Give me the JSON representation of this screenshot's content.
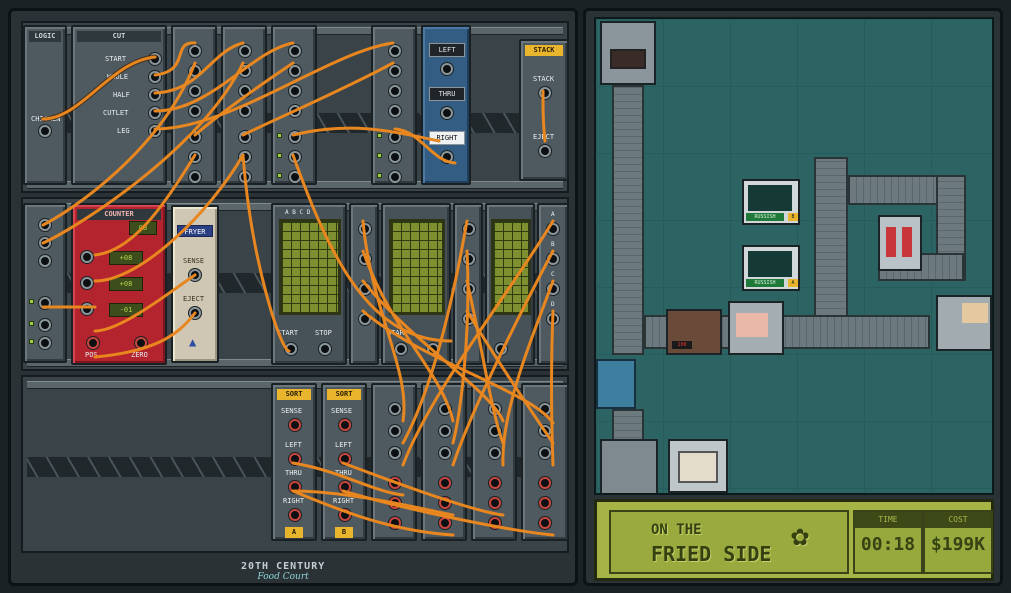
{
  "modules": {
    "chicken": {
      "header": "LOGIC",
      "label": "CHICKEN"
    },
    "cutter": {
      "header": "CUT",
      "labels": [
        "START",
        "WHOLE",
        "HALF",
        "CUTLET",
        "LEG"
      ]
    },
    "sorter": {
      "labels": [
        "LEFT",
        "THRU",
        "RIGHT"
      ]
    },
    "stack": {
      "header": "STACK",
      "label_stack": "STACK",
      "label_eject": "EJECT"
    },
    "counter": {
      "header": "COUNTER",
      "values": [
        "08",
        "+08",
        "+08",
        "-01"
      ],
      "pos_label": "POS",
      "zero_label": "ZERO"
    },
    "fryer": {
      "header": "FRYER",
      "sense_label": "SENSE",
      "eject_label": "EJECT"
    },
    "grid_cols": [
      "A",
      "B",
      "C",
      "D"
    ],
    "grid_start": "START",
    "grid_stop": "STOP",
    "sort_a": {
      "header": "SORT",
      "sense": "SENSE",
      "left": "LEFT",
      "thru": "THRU",
      "right": "RIGHT",
      "tag": "A"
    },
    "sort_b": {
      "header": "SORT",
      "sense": "SENSE",
      "left": "LEFT",
      "thru": "THRU",
      "right": "RIGHT",
      "tag": "B"
    },
    "side_cols": [
      "A",
      "B",
      "C",
      "D"
    ]
  },
  "logo": {
    "line1": "20TH CENTURY",
    "line2": "Food Court"
  },
  "factory": {
    "russish_label": "RUSSISH",
    "tag_a": "A",
    "tag_b": "B",
    "timer_display": "100"
  },
  "status": {
    "title_line1": "ON THE",
    "title_line2": "FRIED SIDE",
    "time_label": "TIME",
    "time_value": "00:18",
    "cost_label": "COST",
    "cost_value": "$199K"
  },
  "colors": {
    "cable": "#e8861f",
    "accent_yellow": "#e8b52c",
    "lcd_green": "#a6b446"
  }
}
